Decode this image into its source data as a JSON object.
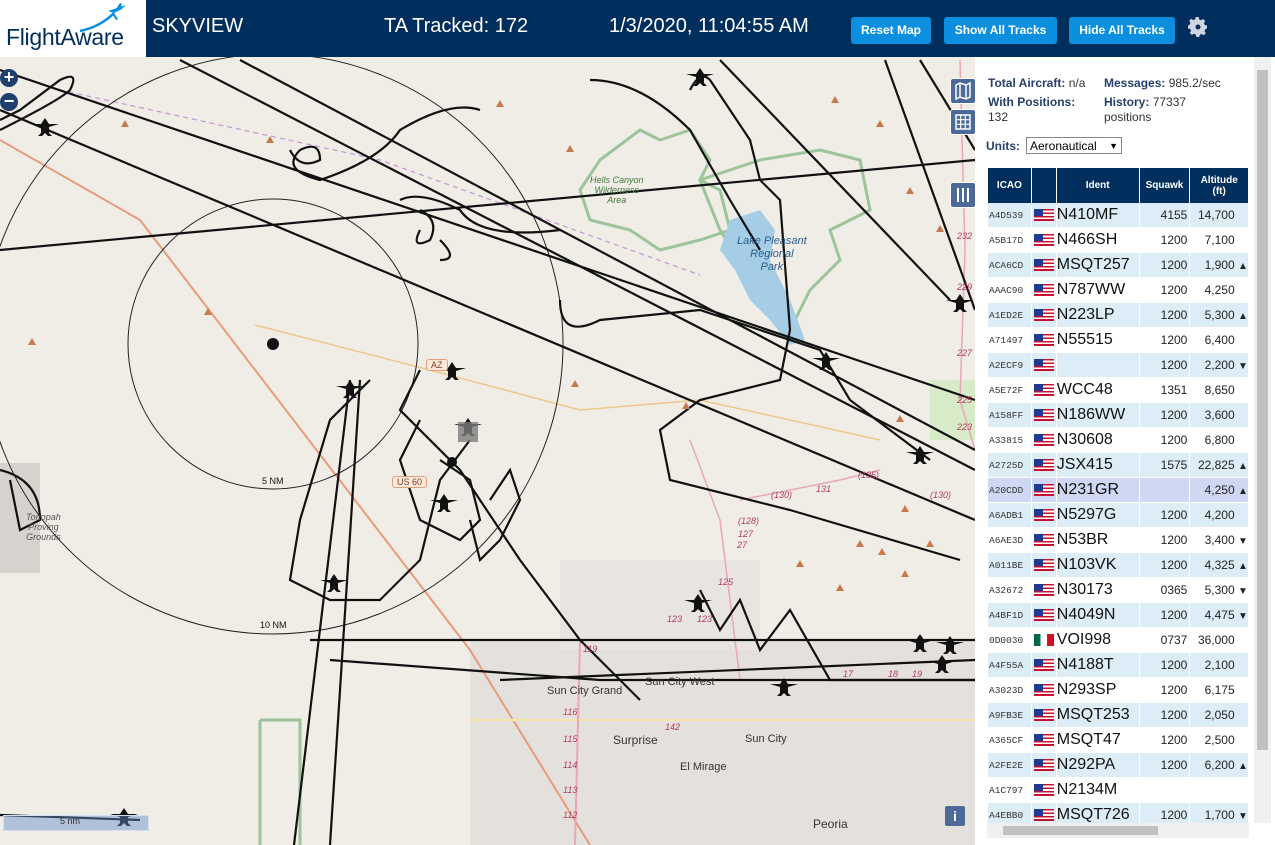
{
  "header": {
    "brand": "FlightAware",
    "app_title": "SKYVIEW",
    "ta_tracked": "TA Tracked: 172",
    "clock": "1/3/2020, 11:04:55 AM",
    "buttons": {
      "reset_map": "Reset Map",
      "show_all_tracks": "Show All Tracks",
      "hide_all_tracks": "Hide All Tracks"
    },
    "settings_icon": "gear-icon",
    "colors": {
      "bar": "#002f5d",
      "button": "#0c8fde"
    }
  },
  "map": {
    "zoom_in": "+",
    "zoom_out": "−",
    "range_rings": [
      "5 NM",
      "10 NM"
    ],
    "road_shields": [
      "AZ",
      "US 60"
    ],
    "labels": {
      "hells_canyon": [
        "Hells Canyon",
        "Wilderness",
        "Area"
      ],
      "lake_pleasant": [
        "Lake Pleasant",
        "Regional",
        "Park"
      ],
      "tonopah": [
        "Tonopah",
        "Proving",
        "Grounds"
      ],
      "sun_city_grand": "Sun City Grand",
      "sun_city_west": "Sun City West",
      "surprise": "Surprise",
      "sun_city": "Sun City",
      "el_mirage": "El Mirage",
      "peoria": "Peoria"
    },
    "road_numbers": [
      "(135)",
      "(130)",
      "131",
      "(128)",
      "127",
      "27",
      "125",
      "123",
      "123",
      "119",
      "116",
      "115",
      "114",
      "113",
      "112",
      "142",
      "17",
      "18",
      "19",
      "232",
      "229",
      "227",
      "225",
      "223",
      "(130)"
    ],
    "scale_text": "5 nm",
    "info_button": "i",
    "controls": [
      "map-icon",
      "grid-icon",
      "columns-icon"
    ]
  },
  "panel": {
    "total_aircraft_label": "Total Aircraft:",
    "total_aircraft_value": "n/a",
    "messages_label": "Messages:",
    "messages_value": "985.2/sec",
    "with_positions_label": "With Positions:",
    "with_positions_value": "132",
    "history_label": "History:",
    "history_value": "77337",
    "history_unit": "positions",
    "units_label": "Units:",
    "units_value": "Aeronautical",
    "columns": {
      "icao": "ICAO",
      "flag": "",
      "ident": "Ident",
      "squawk": "Squawk",
      "altitude": "Altitude",
      "altitude_unit": "(ft)"
    },
    "rows": [
      {
        "icao": "A4D539",
        "flag": "us",
        "ident": "N410MF",
        "squawk": "4155",
        "altitude": "14,700",
        "trend": ""
      },
      {
        "icao": "A5B17D",
        "flag": "us",
        "ident": "N466SH",
        "squawk": "1200",
        "altitude": "7,100",
        "trend": ""
      },
      {
        "icao": "ACA6CD",
        "flag": "us",
        "ident": "MSQT257",
        "squawk": "1200",
        "altitude": "1,900",
        "trend": "▲"
      },
      {
        "icao": "AAAC90",
        "flag": "us",
        "ident": "N787WW",
        "squawk": "1200",
        "altitude": "4,250",
        "trend": ""
      },
      {
        "icao": "A1ED2E",
        "flag": "us",
        "ident": "N223LP",
        "squawk": "1200",
        "altitude": "5,300",
        "trend": "▲"
      },
      {
        "icao": "A71497",
        "flag": "us",
        "ident": "N55515",
        "squawk": "1200",
        "altitude": "6,400",
        "trend": ""
      },
      {
        "icao": "A2ECF9",
        "flag": "us",
        "ident": "",
        "squawk": "1200",
        "altitude": "2,200",
        "trend": "▼"
      },
      {
        "icao": "A5E72F",
        "flag": "us",
        "ident": "WCC48",
        "squawk": "1351",
        "altitude": "8,650",
        "trend": ""
      },
      {
        "icao": "A158FF",
        "flag": "us",
        "ident": "N186WW",
        "squawk": "1200",
        "altitude": "3,600",
        "trend": ""
      },
      {
        "icao": "A33815",
        "flag": "us",
        "ident": "N30608",
        "squawk": "1200",
        "altitude": "6,800",
        "trend": ""
      },
      {
        "icao": "A2725D",
        "flag": "us",
        "ident": "JSX415",
        "squawk": "1575",
        "altitude": "22,825",
        "trend": "▲"
      },
      {
        "icao": "A20CDD",
        "flag": "us",
        "ident": "N231GR",
        "squawk": "",
        "altitude": "4,250",
        "trend": "▲",
        "selected": true
      },
      {
        "icao": "A6ADB1",
        "flag": "us",
        "ident": "N5297G",
        "squawk": "1200",
        "altitude": "4,200",
        "trend": ""
      },
      {
        "icao": "A6AE3D",
        "flag": "us",
        "ident": "N53BR",
        "squawk": "1200",
        "altitude": "3,400",
        "trend": "▼"
      },
      {
        "icao": "A011BE",
        "flag": "us",
        "ident": "N103VK",
        "squawk": "1200",
        "altitude": "4,325",
        "trend": "▲"
      },
      {
        "icao": "A32672",
        "flag": "us",
        "ident": "N30173",
        "squawk": "0365",
        "altitude": "5,300",
        "trend": "▼"
      },
      {
        "icao": "A4BF1D",
        "flag": "us",
        "ident": "N4049N",
        "squawk": "1200",
        "altitude": "4,475",
        "trend": "▼"
      },
      {
        "icao": "0D0030",
        "flag": "mx",
        "ident": "VOI998",
        "squawk": "0737",
        "altitude": "36,000",
        "trend": ""
      },
      {
        "icao": "A4F55A",
        "flag": "us",
        "ident": "N4188T",
        "squawk": "1200",
        "altitude": "2,100",
        "trend": ""
      },
      {
        "icao": "A3023D",
        "flag": "us",
        "ident": "N293SP",
        "squawk": "1200",
        "altitude": "6,175",
        "trend": ""
      },
      {
        "icao": "A9FB3E",
        "flag": "us",
        "ident": "MSQT253",
        "squawk": "1200",
        "altitude": "2,050",
        "trend": ""
      },
      {
        "icao": "A365CF",
        "flag": "us",
        "ident": "MSQT47",
        "squawk": "1200",
        "altitude": "2,500",
        "trend": ""
      },
      {
        "icao": "A2FE2E",
        "flag": "us",
        "ident": "N292PA",
        "squawk": "1200",
        "altitude": "6,200",
        "trend": "▲"
      },
      {
        "icao": "A1C797",
        "flag": "us",
        "ident": "N2134M",
        "squawk": "",
        "altitude": "",
        "trend": ""
      },
      {
        "icao": "A4EBB0",
        "flag": "us",
        "ident": "MSQT726",
        "squawk": "1200",
        "altitude": "1,700",
        "trend": "▼"
      }
    ]
  }
}
